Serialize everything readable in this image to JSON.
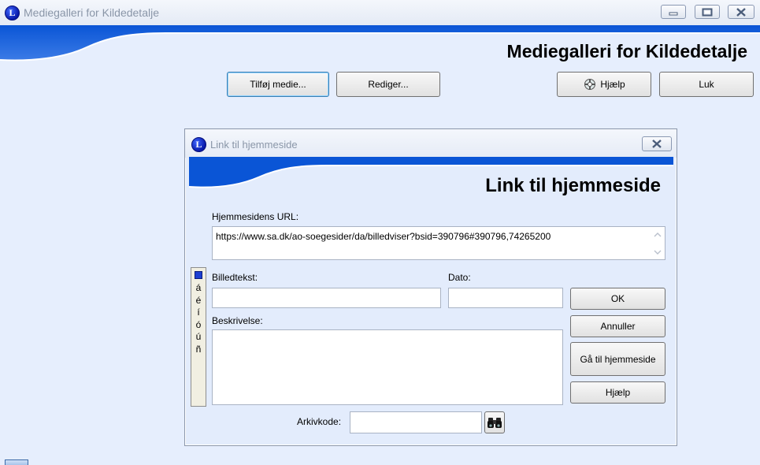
{
  "window": {
    "title": "Mediegalleri for Kildedetalje",
    "banner_title": "Mediegalleri for Kildedetalje",
    "logo_letter": "L"
  },
  "toolbar": {
    "add_media": "Tilføj medie...",
    "edit": "Rediger...",
    "help": "Hjælp",
    "close": "Luk"
  },
  "dialog": {
    "title": "Link til hjemmeside",
    "banner_title": "Link til hjemmeside",
    "logo_letter": "L",
    "url_label": "Hjemmesidens URL:",
    "url_value": "https://www.sa.dk/ao-soegesider/da/billedviser?bsid=390796#390796,74265200",
    "caption_label": "Billedtekst:",
    "caption_value": "",
    "date_label": "Dato:",
    "date_value": "",
    "description_label": "Beskrivelse:",
    "description_value": "",
    "archive_code_label": "Arkivkode:",
    "archive_code_value": "",
    "accent_chars": [
      "á",
      "é",
      "í",
      "ó",
      "ú",
      "ñ"
    ],
    "buttons": {
      "ok": "OK",
      "cancel": "Annuller",
      "goto": "Gå til hjemmeside",
      "help": "Hjælp"
    }
  },
  "colors": {
    "accent_blue": "#0a55d6",
    "background": "#e6eefd"
  }
}
